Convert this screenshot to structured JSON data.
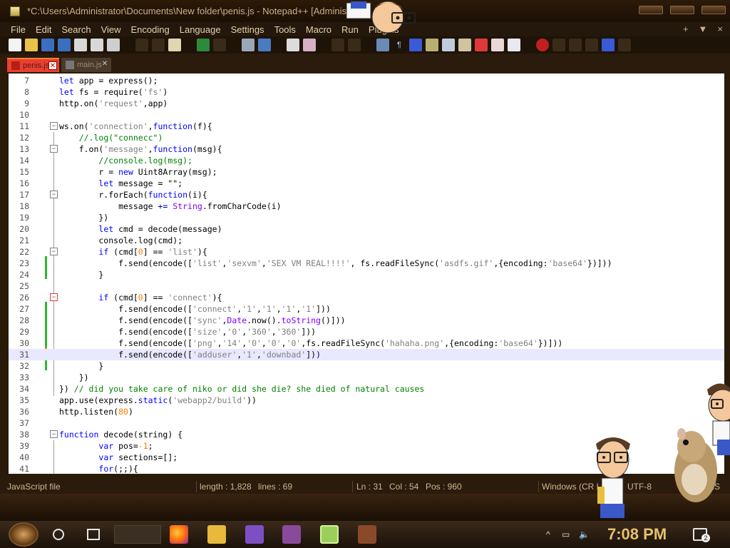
{
  "window": {
    "title": "*C:\\Users\\Administrator\\Documents\\New folder\\penis.js - Notepad++ [Administrat"
  },
  "menu": {
    "items": [
      "File",
      "Edit",
      "Search",
      "View",
      "Encoding",
      "Language",
      "Settings",
      "Tools",
      "Macro",
      "Run",
      "Plugins"
    ],
    "right": [
      "+",
      "▼",
      "×"
    ]
  },
  "tabs": [
    {
      "label": "penis.js",
      "active": true
    },
    {
      "label": "main.js",
      "active": false
    }
  ],
  "editor": {
    "lines": [
      {
        "n": "7",
        "code": [
          [
            "kw",
            "let"
          ],
          [
            "",
            ""
          ],
          [
            "",
            " app = express();"
          ]
        ]
      },
      {
        "n": "8",
        "code": [
          [
            "kw",
            "let"
          ],
          [
            "",
            " fs = require("
          ],
          [
            "str",
            "'fs'"
          ],
          [
            "",
            ")"
          ]
        ]
      },
      {
        "n": "9",
        "code": [
          [
            "",
            "http.on("
          ],
          [
            "str",
            "'request'"
          ],
          [
            "",
            ",app)"
          ]
        ]
      },
      {
        "n": "10",
        "code": []
      },
      {
        "n": "11",
        "code": [
          [
            "",
            "ws.on("
          ],
          [
            "str",
            "'connection'"
          ],
          [
            "",
            ","
          ],
          [
            "kw",
            "function"
          ],
          [
            "",
            "(f){"
          ]
        ]
      },
      {
        "n": "12",
        "code": [
          [
            "",
            "    "
          ],
          [
            "cm",
            "//.log(\"connecc\")"
          ]
        ]
      },
      {
        "n": "13",
        "code": [
          [
            "",
            "    f.on("
          ],
          [
            "str",
            "'message'"
          ],
          [
            "",
            ","
          ],
          [
            "kw",
            "function"
          ],
          [
            "",
            "(msg){"
          ]
        ]
      },
      {
        "n": "14",
        "code": [
          [
            "",
            "        "
          ],
          [
            "cm",
            "//console.log(msg);"
          ]
        ]
      },
      {
        "n": "15",
        "code": [
          [
            "",
            "        r = "
          ],
          [
            "kw",
            "new"
          ],
          [
            "",
            " Uint8Array(msg);"
          ]
        ]
      },
      {
        "n": "16",
        "code": [
          [
            "",
            "        "
          ],
          [
            "kw",
            "let"
          ],
          [
            "",
            " message = \"\";"
          ]
        ]
      },
      {
        "n": "17",
        "code": [
          [
            "",
            "        r.forEach("
          ],
          [
            "kw",
            "function"
          ],
          [
            "",
            "(i){"
          ]
        ]
      },
      {
        "n": "18",
        "code": [
          [
            "",
            "            message "
          ],
          [
            "op",
            "+="
          ],
          [
            "",
            " "
          ],
          [
            "fn",
            "String"
          ],
          [
            "",
            ".fromCharCode(i)"
          ]
        ]
      },
      {
        "n": "19",
        "code": [
          [
            "",
            "        })"
          ]
        ]
      },
      {
        "n": "20",
        "code": [
          [
            "",
            "        "
          ],
          [
            "kw",
            "let"
          ],
          [
            "",
            " cmd = decode(message)"
          ]
        ]
      },
      {
        "n": "21",
        "code": [
          [
            "",
            "        console.log(cmd);"
          ]
        ]
      },
      {
        "n": "22",
        "code": [
          [
            "",
            "        "
          ],
          [
            "kw",
            "if"
          ],
          [
            "",
            " (cmd["
          ],
          [
            "num",
            "0"
          ],
          [
            "",
            "] == "
          ],
          [
            "str",
            "'list'"
          ],
          [
            "",
            "){"
          ]
        ]
      },
      {
        "n": "23",
        "code": [
          [
            "",
            "            f.send(encode(["
          ],
          [
            "str",
            "'list'"
          ],
          [
            "",
            ","
          ],
          [
            "str",
            "'sexvm'"
          ],
          [
            "",
            ","
          ],
          [
            "str",
            "'SEX VM REAL!!!!'"
          ],
          [
            "",
            ", fs.readFileSync("
          ],
          [
            "str",
            "'asdfs.gif'"
          ],
          [
            "",
            ",{encoding:"
          ],
          [
            "str",
            "'base64'"
          ],
          [
            "",
            "})]))"
          ]
        ]
      },
      {
        "n": "24",
        "code": [
          [
            "",
            "        }"
          ]
        ]
      },
      {
        "n": "25",
        "code": []
      },
      {
        "n": "26",
        "code": [
          [
            "",
            "        "
          ],
          [
            "kw",
            "if"
          ],
          [
            "",
            " (cmd["
          ],
          [
            "num",
            "0"
          ],
          [
            "",
            "] == "
          ],
          [
            "str",
            "'connect'"
          ],
          [
            "",
            "){"
          ]
        ]
      },
      {
        "n": "27",
        "code": [
          [
            "",
            "            f.send(encode(["
          ],
          [
            "str",
            "'connect'"
          ],
          [
            "",
            ","
          ],
          [
            "str",
            "'1'"
          ],
          [
            "",
            ","
          ],
          [
            "str",
            "'1'"
          ],
          [
            "",
            ","
          ],
          [
            "str",
            "'1'"
          ],
          [
            "",
            ","
          ],
          [
            "str",
            "'1'"
          ],
          [
            "",
            "]))"
          ]
        ]
      },
      {
        "n": "28",
        "code": [
          [
            "",
            "            f.send(encode(["
          ],
          [
            "str",
            "'sync'"
          ],
          [
            "",
            ","
          ],
          [
            "fn",
            "Date"
          ],
          [
            "",
            ".now()."
          ],
          [
            "fn",
            "toString"
          ],
          [
            "",
            "()]))"
          ]
        ]
      },
      {
        "n": "29",
        "code": [
          [
            "",
            "            f.send(encode(["
          ],
          [
            "str",
            "'size'"
          ],
          [
            "",
            ","
          ],
          [
            "str",
            "'0'"
          ],
          [
            "",
            ","
          ],
          [
            "str",
            "'360'"
          ],
          [
            "",
            ","
          ],
          [
            "str",
            "'360'"
          ],
          [
            "",
            "]))"
          ]
        ]
      },
      {
        "n": "30",
        "code": [
          [
            "",
            "            f.send(encode(["
          ],
          [
            "str",
            "'png'"
          ],
          [
            "",
            ","
          ],
          [
            "str",
            "'14'"
          ],
          [
            "",
            ","
          ],
          [
            "str",
            "'0'"
          ],
          [
            "",
            ","
          ],
          [
            "str",
            "'0'"
          ],
          [
            "",
            ","
          ],
          [
            "str",
            "'0'"
          ],
          [
            "",
            ",fs.readFileSync("
          ],
          [
            "str",
            "'hahaha.png'"
          ],
          [
            "",
            ",{encoding:"
          ],
          [
            "str",
            "'base64'"
          ],
          [
            "",
            "})]))"
          ]
        ]
      },
      {
        "n": "31",
        "code": [
          [
            "",
            "            f.send(encode(["
          ],
          [
            "str",
            "'adduser'"
          ],
          [
            "",
            ","
          ],
          [
            "str",
            "'1'"
          ],
          [
            "",
            ","
          ],
          [
            "str",
            "'downbad'"
          ],
          [
            "",
            "])"
          ],
          [
            "op",
            ")"
          ]
        ]
      },
      {
        "n": "32",
        "code": [
          [
            "",
            "        }"
          ]
        ]
      },
      {
        "n": "33",
        "code": [
          [
            "",
            "    })"
          ]
        ]
      },
      {
        "n": "34",
        "code": [
          [
            "",
            "}) "
          ],
          [
            "cm",
            "// did you take care of niko or did she die? she died of natural causes"
          ]
        ]
      },
      {
        "n": "35",
        "code": [
          [
            "",
            "app.use(express."
          ],
          [
            "kw",
            "static"
          ],
          [
            "",
            "("
          ],
          [
            "str",
            "'webapp2/build'"
          ],
          [
            "",
            "))"
          ]
        ]
      },
      {
        "n": "36",
        "code": [
          [
            "",
            "http.listen("
          ],
          [
            "num",
            "80"
          ],
          [
            "",
            ")"
          ]
        ]
      },
      {
        "n": "37",
        "code": []
      },
      {
        "n": "38",
        "code": [
          [
            "kw",
            "function"
          ],
          [
            "",
            " decode(string) {"
          ]
        ]
      },
      {
        "n": "39",
        "code": [
          [
            "",
            "        "
          ],
          [
            "kw",
            "var"
          ],
          [
            "",
            " pos="
          ],
          [
            "num",
            "-1"
          ],
          [
            "",
            ";"
          ]
        ]
      },
      {
        "n": "40",
        "code": [
          [
            "",
            "        "
          ],
          [
            "kw",
            "var"
          ],
          [
            "",
            " sections=[];"
          ]
        ]
      },
      {
        "n": "41",
        "code": [
          [
            "",
            "        "
          ],
          [
            "kw",
            "for"
          ],
          [
            "",
            "(;;){"
          ]
        ]
      }
    ]
  },
  "status": {
    "filetype": "JavaScript file",
    "length": "length : 1,828",
    "lines": "lines : 69",
    "ln": "Ln : 31",
    "col": "Col : 54",
    "pos": "Pos : 960",
    "eol": "Windows (CR LF)",
    "encoding": "UTF-8",
    "ins": "INS"
  },
  "taskbar": {
    "clock": "7:08 PM",
    "notifications": "2"
  },
  "colors": {
    "keyword": "#0000ff",
    "string": "#808080",
    "comment": "#008000",
    "accent": "#e9402f"
  }
}
